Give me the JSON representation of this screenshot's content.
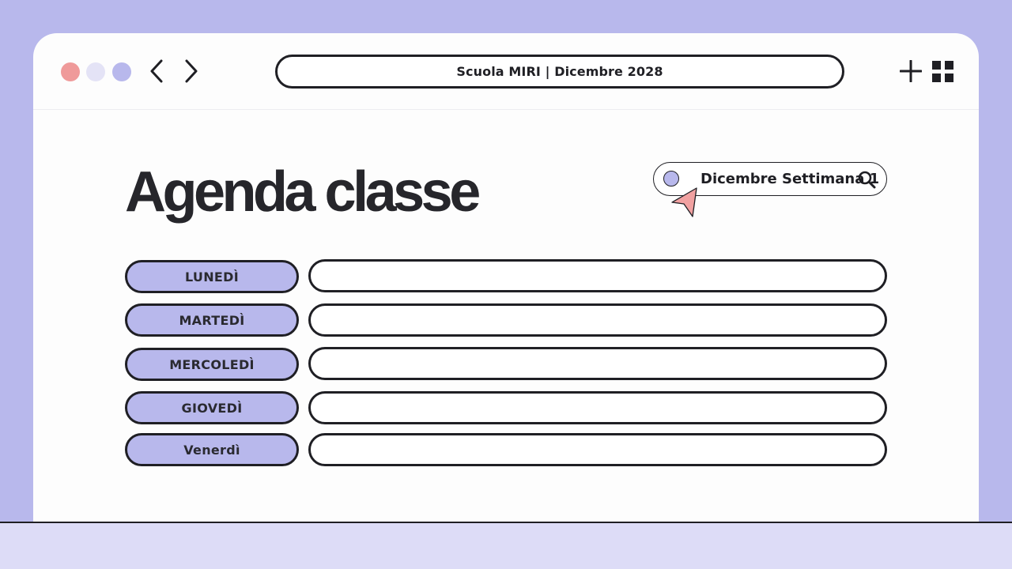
{
  "colors": {
    "background": "#b8b8ec",
    "window": "#fdfdfd",
    "accent_purple": "#b8b8ec",
    "dot_red": "#ef9a9a",
    "dot_light": "#e4e3f6",
    "cursor_pink": "#f1a1a1",
    "outline": "#1f1f24",
    "footer": "#dddcf7"
  },
  "titlebar": {
    "address": "Scuola MIRI | Dicembre 2028",
    "icons": {
      "back": "chevron-left-icon",
      "forward": "chevron-right-icon",
      "add": "plus-icon",
      "apps": "grid-icon"
    }
  },
  "page": {
    "title": "Agenda classe",
    "search": {
      "value": "Dicembre Settimana 1",
      "icon": "search-icon"
    }
  },
  "agenda": {
    "days": [
      {
        "label": "LUNEDÌ",
        "entry": ""
      },
      {
        "label": "MARTEDÌ",
        "entry": ""
      },
      {
        "label": "MERCOLEDÌ",
        "entry": ""
      },
      {
        "label": "GIOVEDÌ",
        "entry": ""
      },
      {
        "label": "Venerdì",
        "entry": ""
      }
    ]
  }
}
